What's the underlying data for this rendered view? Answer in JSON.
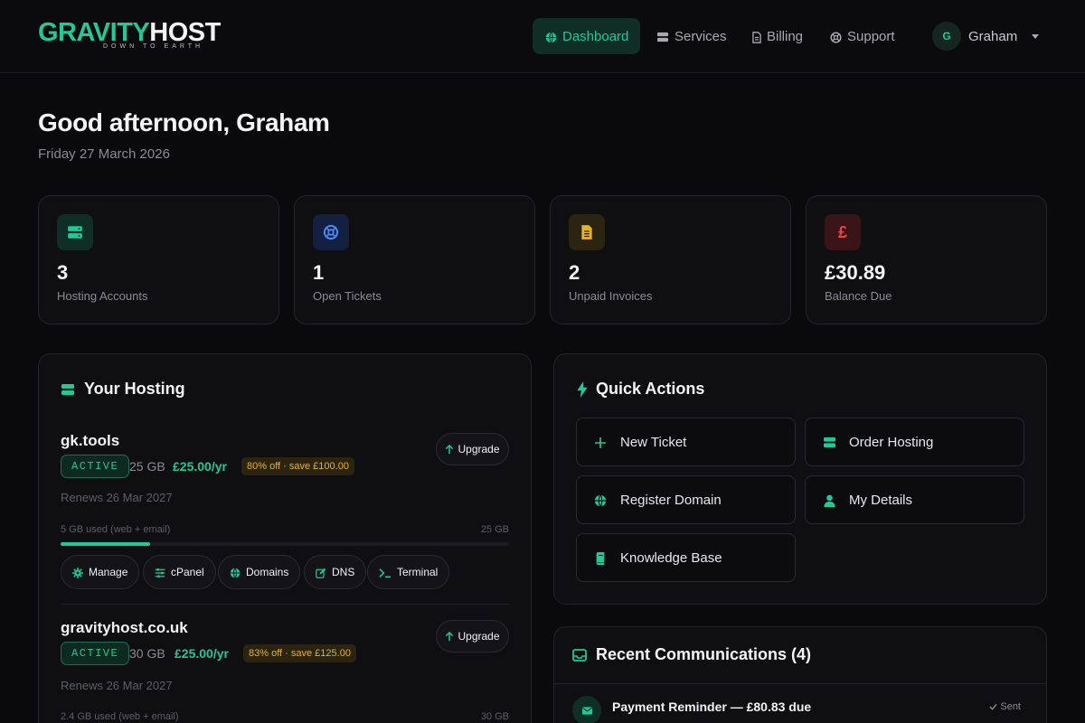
{
  "brand": {
    "name_part1": "GRAVITY",
    "name_part2": "HOST",
    "tagline": "DOWN TO EARTH",
    "accent": "#20c997"
  },
  "nav": [
    {
      "label": "Dashboard",
      "icon": "globe-icon",
      "active": true
    },
    {
      "label": "Services",
      "icon": "server-icon",
      "active": false
    },
    {
      "label": "Billing",
      "icon": "document-icon",
      "active": false
    },
    {
      "label": "Support",
      "icon": "lifebuoy-icon",
      "active": false
    }
  ],
  "user": {
    "initial": "G",
    "name": "Graham"
  },
  "greeting": "Good afternoon, Graham",
  "date": "Friday 27 March 2026",
  "stats": [
    {
      "value": "3",
      "label": "Hosting Accounts",
      "icon": "server-icon",
      "color": "#20c997"
    },
    {
      "value": "1",
      "label": "Open Tickets",
      "icon": "lifebuoy-icon",
      "color": "#4a86f7"
    },
    {
      "value": "2",
      "label": "Unpaid Invoices",
      "icon": "document-icon",
      "color": "#e8b22b"
    },
    {
      "value": "£30.89",
      "label": "Balance Due",
      "icon": "pound-icon",
      "glyph": "£",
      "color": "#ef4444"
    }
  ],
  "hosting": {
    "title": "Your Hosting",
    "items": [
      {
        "domain": "gk.tools",
        "status": "ACTIVE",
        "size": "25 GB",
        "price": "£25.00/yr",
        "promo": "80% off · save £100.00",
        "upgrade": "Upgrade",
        "renews": "Renews 26 Mar 2027",
        "usage": "5 GB used (web + email)",
        "usage_max": "25 GB",
        "usage_fraction": 0.2
      },
      {
        "domain": "gravityhost.co.uk",
        "status": "ACTIVE",
        "size": "30 GB",
        "price": "£25.00/yr",
        "promo": "83% off · save £125.00",
        "upgrade": "Upgrade",
        "renews": "Renews 26 Mar 2027",
        "usage": "2.4 GB used (web + email)",
        "usage_max": "30 GB",
        "usage_fraction": 0.08
      }
    ],
    "actions": [
      "Manage",
      "cPanel",
      "Domains",
      "DNS",
      "Terminal"
    ]
  },
  "quick_actions": {
    "title": "Quick Actions",
    "items": [
      "New Ticket",
      "Order Hosting",
      "Register Domain",
      "My Details",
      "Knowledge Base"
    ]
  },
  "communications": {
    "title": "Recent Communications (4)",
    "items": [
      {
        "title": "Payment Reminder — £80.83 due",
        "status": "Sent"
      }
    ]
  }
}
